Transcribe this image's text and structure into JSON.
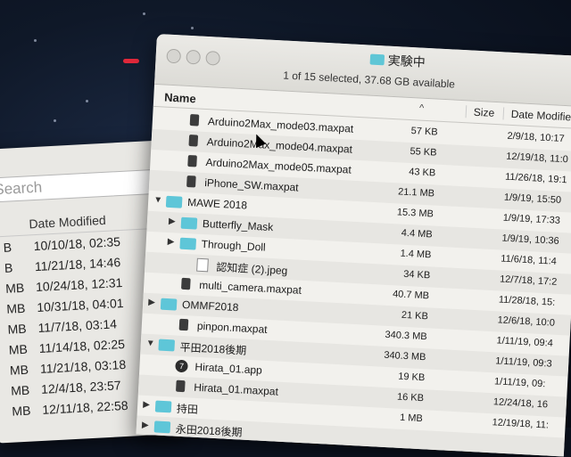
{
  "back_window": {
    "search_placeholder": "Search",
    "header_date": "Date Modified",
    "rows": [
      {
        "size": "B",
        "date": "10/10/18, 02:35"
      },
      {
        "size": "B",
        "date": "11/21/18, 14:46"
      },
      {
        "size": "MB",
        "date": "10/24/18, 12:31"
      },
      {
        "size": "MB",
        "date": "10/31/18, 04:01"
      },
      {
        "size": "MB",
        "date": "11/7/18, 03:14"
      },
      {
        "size": "MB",
        "date": "11/14/18, 02:25"
      },
      {
        "size": "MB",
        "date": "11/21/18, 03:18"
      },
      {
        "size": "MB",
        "date": "12/4/18, 23:57"
      },
      {
        "size": "MB",
        "date": "12/11/18, 22:58"
      }
    ]
  },
  "window": {
    "title": "実験中",
    "status": "1 of 15 selected, 37.68 GB available",
    "columns": {
      "name": "Name",
      "size": "Size",
      "date": "Date Modified"
    },
    "rows": [
      {
        "indent": 1,
        "kind": "file",
        "name": "Arduino2Max_mode03.maxpat",
        "size": "57 KB",
        "date": "2/9/18, 10:17"
      },
      {
        "indent": 1,
        "kind": "file",
        "name": "Arduino2Max_mode04.maxpat",
        "size": "55 KB",
        "date": "12/19/18, 11:0"
      },
      {
        "indent": 1,
        "kind": "file",
        "name": "Arduino2Max_mode05.maxpat",
        "size": "43 KB",
        "date": "11/26/18, 19:1"
      },
      {
        "indent": 1,
        "kind": "file",
        "name": "iPhone_SW.maxpat",
        "size": "21.1 MB",
        "date": "1/9/19, 15:50"
      },
      {
        "indent": 0,
        "kind": "folder",
        "expanded": true,
        "name": "MAWE 2018",
        "size": "15.3 MB",
        "date": "1/9/19, 17:33"
      },
      {
        "indent": 1,
        "kind": "folder",
        "expanded": false,
        "name": "Butterfly_Mask",
        "size": "4.4 MB",
        "date": "1/9/19, 10:36"
      },
      {
        "indent": 1,
        "kind": "folder",
        "expanded": false,
        "name": "Through_Doll",
        "size": "1.4 MB",
        "date": "11/6/18, 11:4"
      },
      {
        "indent": 2,
        "kind": "img",
        "name": "認知症 (2).jpeg",
        "size": "34 KB",
        "date": "12/7/18, 17:2"
      },
      {
        "indent": 1,
        "kind": "file",
        "name": "multi_camera.maxpat",
        "size": "40.7 MB",
        "date": "11/28/18, 15:"
      },
      {
        "indent": 0,
        "kind": "folder",
        "expanded": false,
        "name": "OMMF2018",
        "size": "21 KB",
        "date": "12/6/18, 10:0"
      },
      {
        "indent": 1,
        "kind": "file",
        "name": "pinpon.maxpat",
        "size": "340.3 MB",
        "date": "1/11/19, 09:4"
      },
      {
        "indent": 0,
        "kind": "folder",
        "expanded": true,
        "name": "平田2018後期",
        "size": "340.3 MB",
        "date": "1/11/19, 09:3"
      },
      {
        "indent": 1,
        "kind": "app",
        "name": "Hirata_01.app",
        "size": "19 KB",
        "date": "1/11/19, 09:"
      },
      {
        "indent": 1,
        "kind": "file",
        "name": "Hirata_01.maxpat",
        "size": "16 KB",
        "date": "12/24/18, 16"
      },
      {
        "indent": 0,
        "kind": "folder",
        "expanded": false,
        "name": "持田",
        "size": "1 MB",
        "date": "12/19/18, 11:"
      },
      {
        "indent": 0,
        "kind": "folder",
        "expanded": false,
        "name": "永田2018後期",
        "size": "",
        "date": ""
      }
    ]
  }
}
